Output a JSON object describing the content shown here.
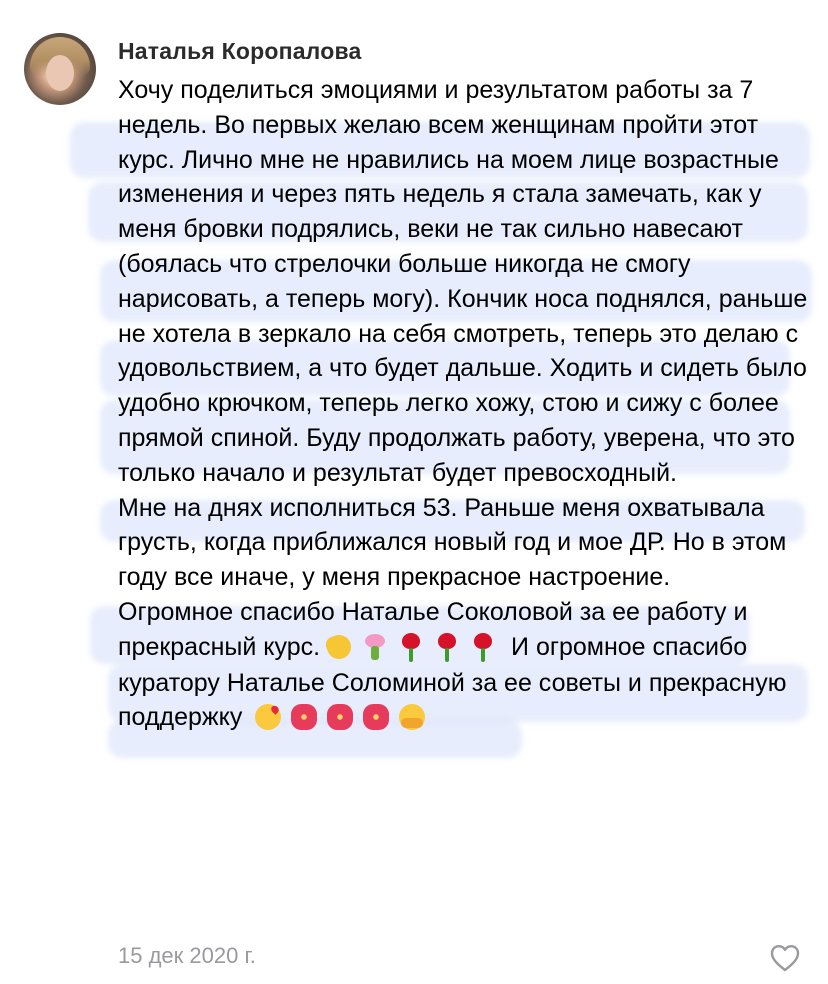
{
  "comment": {
    "author": "Наталья Коропалова",
    "paragraph1": "Хочу поделиться эмоциями и результатом работы за 7 недель. Во первых желаю всем женщинам пройти этот курс. Лично мне не нравились на моем лице возрастные изменения и через пять недель я стала замечать, как у меня бровки подрялись, веки не так сильно навесают (боялась что стрелочки больше никогда не смогу нарисовать, а теперь могу). Кончик носа поднялся, раньше не хотела в зеркало на себя смотреть, теперь это делаю с удовольствием, а что будет дальше. Ходить и сидеть было удобно крючком, теперь легко хожу, стою и сижу с более прямой спиной. Буду продолжать работу, уверена, что это только начало и результат будет превосходный.",
    "paragraph2": "Мне на днях исполниться 53. Раньше меня охватывала грусть, когда приближался новый год и мое ДР. Но в этом году все иначе, у меня прекрасное настроение.",
    "paragraph3_part1": "Огромное спасибо Наталье Соколовой за ее работу и прекрасный курс.",
    "paragraph3_part2": " И огромное спасибо куратору Наталье Соломиной за ее советы и прекрасную поддержку ",
    "emojis_after_course": [
      "waving-hand",
      "bouquet",
      "rose",
      "rose",
      "rose"
    ],
    "emojis_end": [
      "face-blowing-kiss",
      "hibiscus",
      "hibiscus",
      "hibiscus",
      "hugging-face"
    ],
    "date": "15 дек 2020 г."
  },
  "icons": {
    "like": "heart-outline-icon"
  },
  "colors": {
    "text": "#000000",
    "author": "#2b2b2b",
    "muted": "#9a9a9e",
    "highlight": "#aabef5"
  }
}
